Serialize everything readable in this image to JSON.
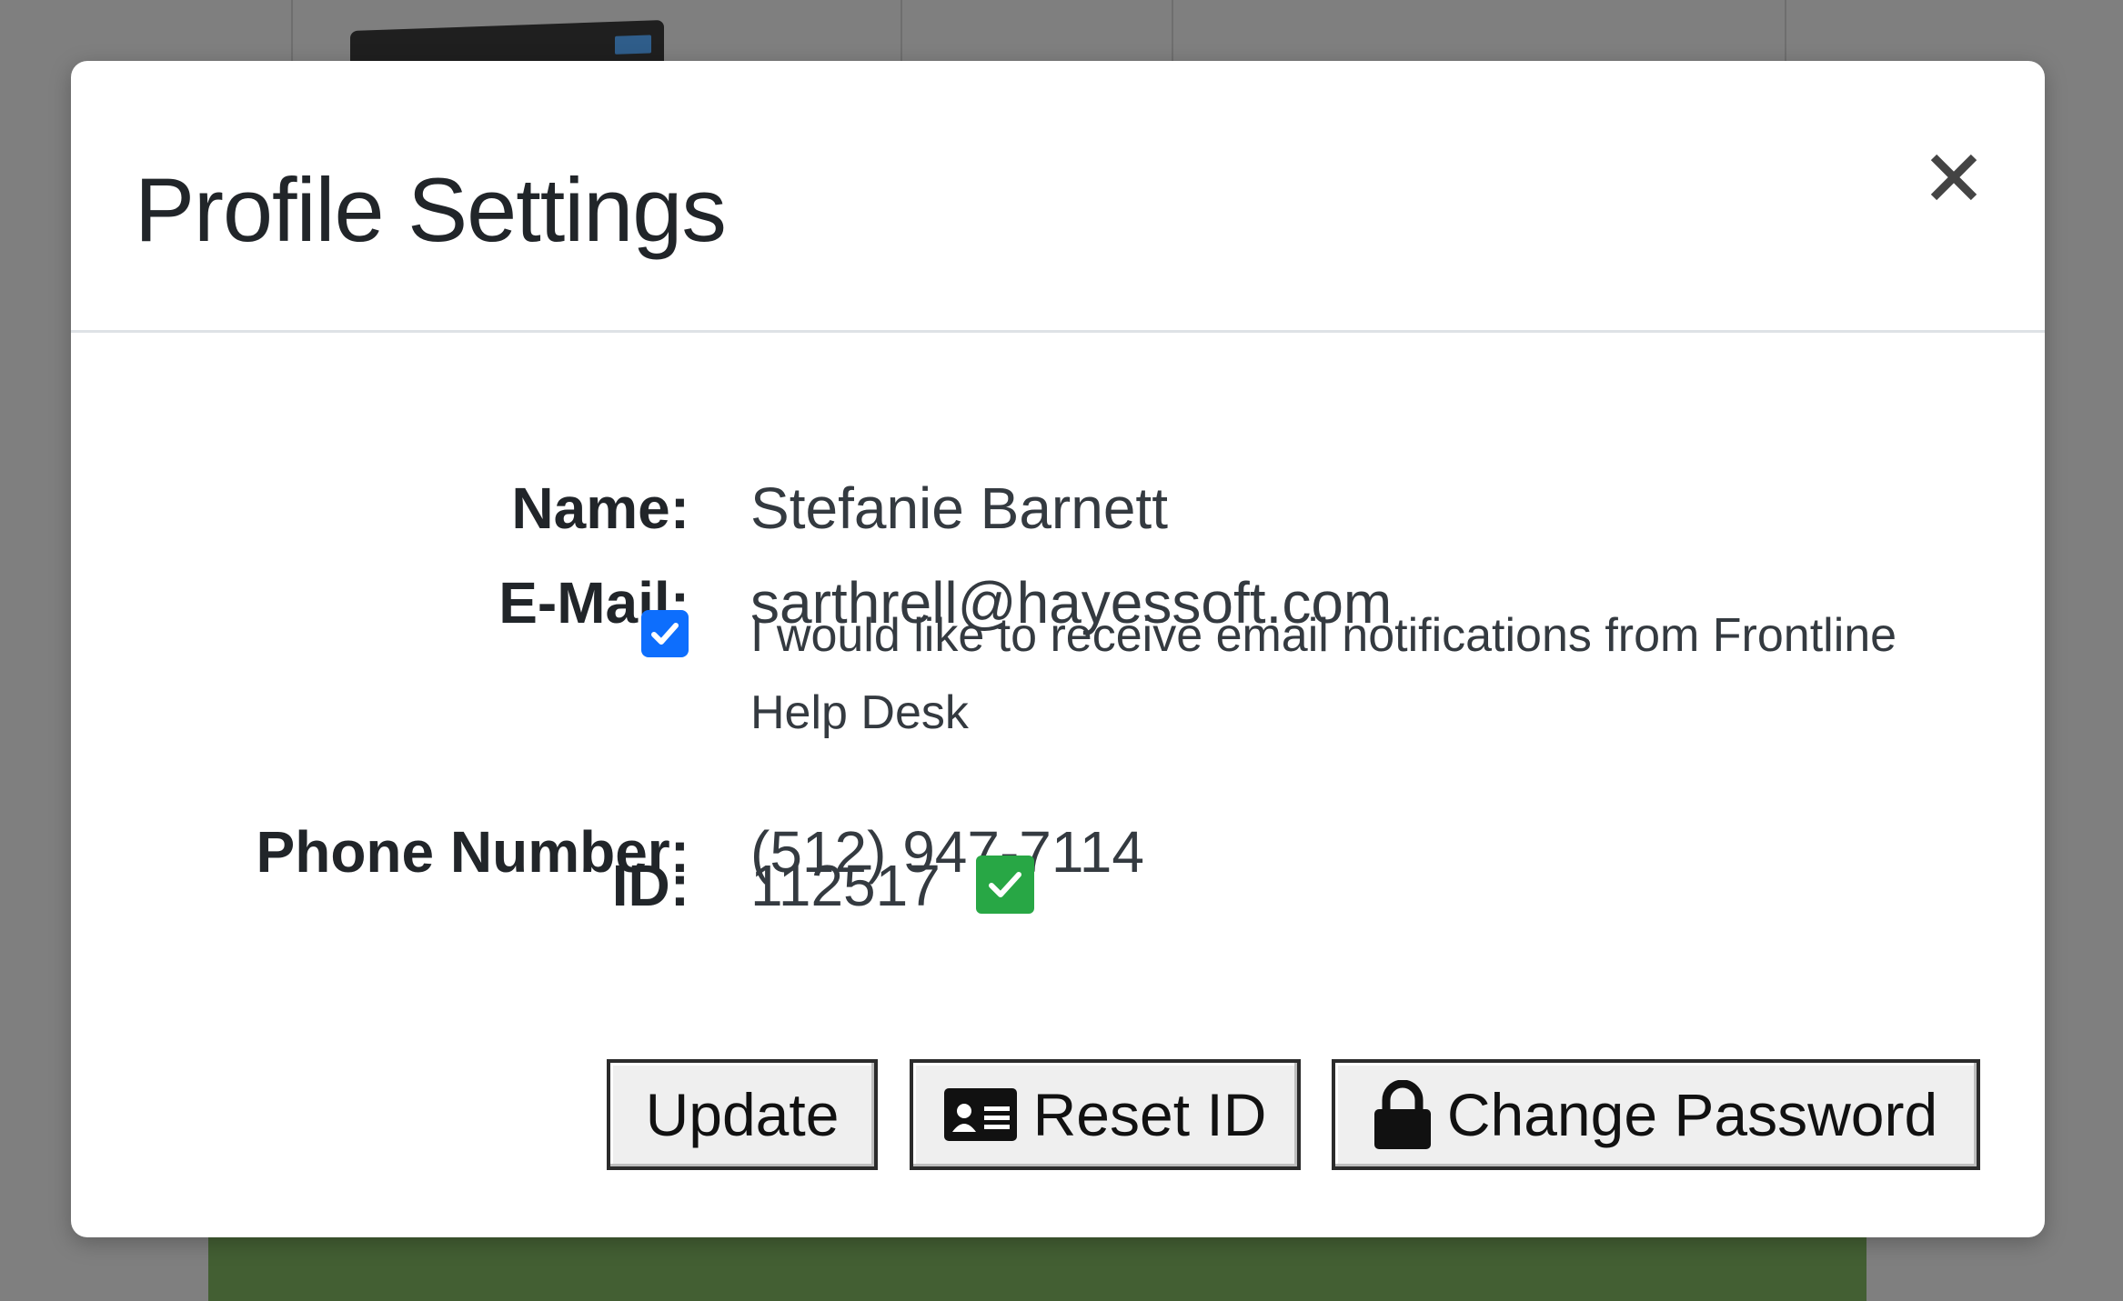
{
  "modal": {
    "title": "Profile Settings",
    "close_symbol": "×"
  },
  "profile": {
    "name_label": "Name:",
    "name_value": "Stefanie Barnett",
    "email_label": "E-Mail:",
    "email_value": "sarthrell@hayessoft.com",
    "notifications_checked": true,
    "notifications_text": "I would like to receive email notifications from Frontline Help Desk",
    "phone_label": "Phone Number:",
    "phone_value": "(512) 947-7114",
    "id_label": "ID:",
    "id_value": "112517",
    "id_verified": true
  },
  "buttons": {
    "update_label": "Update",
    "reset_id_label": "Reset ID",
    "change_password_label": "Change Password"
  },
  "icons": {
    "close": "close-icon",
    "checkbox": "checkmark-icon",
    "verified": "check-square-icon",
    "reset_id": "id-card-icon",
    "change_password": "lock-icon"
  },
  "colors": {
    "checkbox_accent": "#0d6efd",
    "verified_badge": "#28a745",
    "overlay": "#808080",
    "background_bar": "#435f33"
  }
}
